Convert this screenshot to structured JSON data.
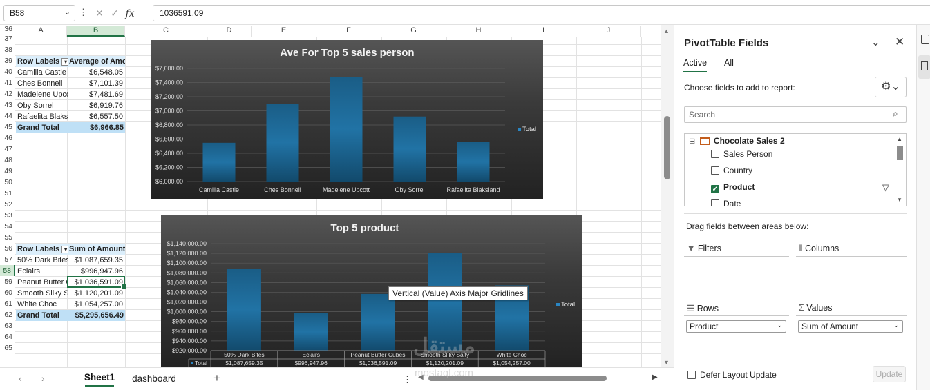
{
  "formula_bar": {
    "name_box": "B58",
    "formula": "1036591.09",
    "fx_label": "fx",
    "cancel_icon": "x-icon",
    "enter_icon": "check-icon"
  },
  "columns": [
    "A",
    "B",
    "C",
    "D",
    "E",
    "F",
    "G",
    "H",
    "I",
    "J"
  ],
  "rows": [
    "36",
    "37",
    "38",
    "39",
    "40",
    "41",
    "42",
    "43",
    "44",
    "45",
    "46",
    "47",
    "48",
    "49",
    "50",
    "51",
    "52",
    "53",
    "54",
    "55",
    "56",
    "57",
    "58",
    "59",
    "60",
    "61",
    "62",
    "63",
    "64",
    "65"
  ],
  "pivot1": {
    "header_labels": "Row Labels",
    "header_value": "Average of Amount",
    "rows": [
      {
        "label": "Camilla Castle",
        "value": "$6,548.05"
      },
      {
        "label": "Ches Bonnell",
        "value": "$7,101.39"
      },
      {
        "label": "Madelene Upco",
        "value": "$7,481.69"
      },
      {
        "label": "Oby Sorrel",
        "value": "$6,919.76"
      },
      {
        "label": "Rafaelita Blaks",
        "value": "$6,557.50"
      }
    ],
    "total_label": "Grand Total",
    "total_value": "$6,966.85"
  },
  "pivot2": {
    "header_labels": "Row Labels",
    "header_value": "Sum of Amount",
    "rows": [
      {
        "label": "50% Dark Bites",
        "value": "$1,087,659.35"
      },
      {
        "label": "Eclairs",
        "value": "$996,947.96"
      },
      {
        "label": "Peanut Butter C",
        "value": "$1,036,591.09"
      },
      {
        "label": "Smooth Sliky Sa",
        "value": "$1,120,201.09"
      },
      {
        "label": "White Choc",
        "value": "$1,054,257.00"
      }
    ],
    "total_label": "Grand Total",
    "total_value": "$5,295,656.49"
  },
  "chart_data": [
    {
      "type": "bar",
      "title": "Ave For Top 5 sales person",
      "categories": [
        "Camilla Castle",
        "Ches Bonnell",
        "Madelene Upcott",
        "Oby Sorrel",
        "Rafaelita Blaksland"
      ],
      "series": [
        {
          "name": "Total",
          "values": [
            6548.05,
            7101.39,
            7481.69,
            6919.76,
            6557.5
          ]
        }
      ],
      "ylim": [
        6000,
        7600
      ],
      "yticks": [
        "$6,000.00",
        "$6,200.00",
        "$6,400.00",
        "$6,600.00",
        "$6,800.00",
        "$7,000.00",
        "$7,200.00",
        "$7,400.00",
        "$7,600.00"
      ],
      "ytick_values": [
        6000,
        6200,
        6400,
        6600,
        6800,
        7000,
        7200,
        7400,
        7600
      ],
      "legend": "right",
      "colors": {
        "bar": "#1f6f9f",
        "background": "#3a3a3a"
      }
    },
    {
      "type": "bar",
      "title": "Top 5 product",
      "categories": [
        "50% Dark Bites",
        "Eclairs",
        "Peanut Butter Cubes",
        "Smooth Sliky Salty",
        "White Choc"
      ],
      "series": [
        {
          "name": "Total",
          "values": [
            1087659.35,
            996947.96,
            1036591.09,
            1120201.09,
            1054257.0
          ]
        }
      ],
      "data_table": [
        "$1,087,659.35",
        "$996,947.96",
        "$1,036,591.09",
        "$1,120,201.09",
        "$1,054,257.00"
      ],
      "ylim": [
        920000,
        1140000
      ],
      "yticks": [
        "$920,000.00",
        "$940,000.00",
        "$960,000.00",
        "$980,000.00",
        "$1,000,000.00",
        "$1,020,000.00",
        "$1,040,000.00",
        "$1,060,000.00",
        "$1,080,000.00",
        "$1,100,000.00",
        "$1,120,000.00",
        "$1,140,000.00"
      ],
      "ytick_values": [
        920000,
        940000,
        960000,
        980000,
        1000000,
        1020000,
        1040000,
        1060000,
        1080000,
        1100000,
        1120000,
        1140000
      ],
      "legend": "right",
      "colors": {
        "bar": "#1f6f9f",
        "background": "#3a3a3a"
      }
    }
  ],
  "tooltip": "Vertical (Value) Axis Major Gridlines",
  "sheet_tabs": [
    "Sheet1",
    "dashboard"
  ],
  "add_sheet": "+",
  "pane": {
    "title": "PivotTable Fields",
    "tabs": [
      "Active",
      "All"
    ],
    "choose_label": "Choose fields to add to report:",
    "search_placeholder": "Search",
    "table_name": "Chocolate Sales  2",
    "fields": [
      {
        "name": "Sales Person",
        "checked": false
      },
      {
        "name": "Country",
        "checked": false
      },
      {
        "name": "Product",
        "checked": true
      },
      {
        "name": "Date",
        "checked": false
      }
    ],
    "drag_label": "Drag fields between areas below:",
    "areas": {
      "filters": "Filters",
      "columns": "Columns",
      "rows": "Rows",
      "values": "Values"
    },
    "rows_field": "Product",
    "values_field": "Sum of Amount",
    "defer_label": "Defer Layout Update",
    "update_label": "Update"
  },
  "watermark": {
    "arabic": "مستقل",
    "latin": "mostaql.com"
  }
}
